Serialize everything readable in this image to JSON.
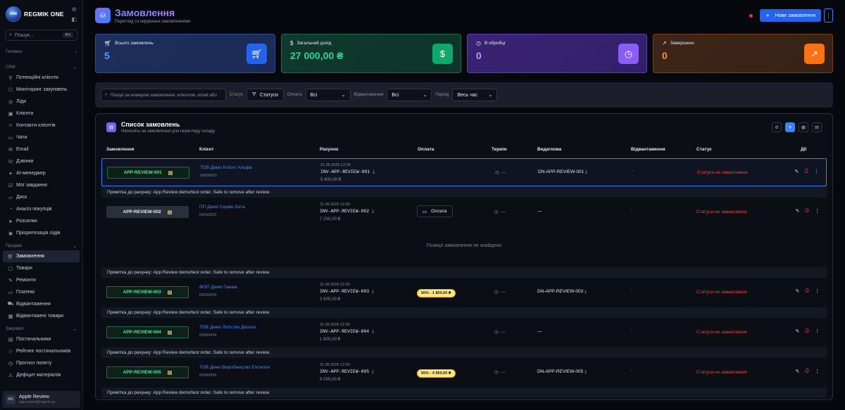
{
  "sidebar": {
    "brand": "REGMIK ONE",
    "logo_text": "ONE",
    "search_placeholder": "Пошук...",
    "search_kbd": "⌘K",
    "sec_main": "Головна",
    "sec_crm": "CRM",
    "crm": [
      "Потенційні клієнти",
      "Моніторинг закупівель",
      "Ліди",
      "Клієнти",
      "Контакти клієнтів",
      "Чати",
      "Email",
      "Дзвінки",
      "AI-менеджер",
      "Мої завдання",
      "Диск",
      "Аналіз покупців",
      "Розсилки",
      "Пріоритезація лідів"
    ],
    "sec_sales": "Продажі",
    "sales": [
      "Замовлення",
      "Товари",
      "Ремонти",
      "Платежі",
      "Відвантаження",
      "Відвантажені товари"
    ],
    "sec_purchases": "Закупівлі",
    "purchases": [
      "Постачальники",
      "Рейтинг постачальників",
      "Прогноз попиту",
      "Дефіцит матеріалів"
    ],
    "user": {
      "initials": "AR",
      "name": "Apple Review",
      "email": "app.review@regmik.ua"
    }
  },
  "header": {
    "title": "Замовлення",
    "subtitle": "Перегляд та керування замовленнями",
    "new_button": "Нове замовлення"
  },
  "stats": [
    {
      "label": "Всього замовлень",
      "value": "5"
    },
    {
      "label": "Загальний дохід",
      "value": "27 000,00 ₴"
    },
    {
      "label": "В обробці",
      "value": "0"
    },
    {
      "label": "Завершено",
      "value": "0"
    }
  ],
  "filters": {
    "search_placeholder": "Пошук за номером замовлення, клієнтом, email або",
    "status_label": "Статус",
    "status_button": "Статуси",
    "payment_label": "Оплата",
    "payment_value": "Всі",
    "shipping_label": "Відвантаження",
    "shipping_value": "Всі",
    "period_label": "Період",
    "period_value": "Весь час"
  },
  "list": {
    "title": "Список замовлень",
    "subtitle": "Натисніть на замовлення для перегляду складу",
    "columns": [
      "Замовлення",
      "Клієнт",
      "Рахунок",
      "Оплата",
      "Термін",
      "Видаткова",
      "Відвантаження",
      "Статус",
      "Дії"
    ],
    "empty_text": "Позиції замовлення не знайдено",
    "note_label": "Примітка до рахунку:",
    "note_text": "App Review demo/test order. Safe to remove after review.",
    "pay_button": "Оплата",
    "term_text": "---",
    "ship_dash": "—",
    "otg_dash": "-",
    "status_text": "Статуси не завантажені"
  },
  "orders": [
    {
      "number": "APP-REVIEW-001",
      "client": "ТОВ Демо Клієнт Альфа",
      "code": "00000001",
      "inv_date": "21.06.2026 12:00",
      "invoice": "INV-APP-REVIEW-001",
      "amount": "5 400,00 ₴",
      "payment": "",
      "shipping_doc": "DN-APP-REVIEW-001"
    },
    {
      "number": "APP-REVIEW-002",
      "client": "ПП Демо Сервіс Бета",
      "code": "00000002",
      "inv_date": "21.06.2026 12:00",
      "invoice": "INV-APP-REVIEW-002",
      "amount": "7 200,00 ₴",
      "payment": "",
      "shipping_doc": ""
    },
    {
      "number": "APP-REVIEW-003",
      "client": "ФОП Демо Гамма",
      "code": "00000003",
      "inv_date": "21.06.2026 12:00",
      "invoice": "INV-APP-REVIEW-003",
      "amount": "3 600,00 ₴",
      "payment": "50% - 1 800,00 ₴",
      "shipping_doc": "DN-APP-REVIEW-003"
    },
    {
      "number": "APP-REVIEW-004",
      "client": "ТОВ Демо Логістик Дельта",
      "code": "00000004",
      "inv_date": "21.06.2026 12:00",
      "invoice": "INV-APP-REVIEW-004",
      "amount": "1 800,00 ₴",
      "payment": "",
      "shipping_doc": ""
    },
    {
      "number": "APP-REVIEW-005",
      "client": "ТОВ Демо Виробництво Епсилон",
      "code": "00000005",
      "inv_date": "21.06.2026 12:00",
      "invoice": "INV-APP-REVIEW-005",
      "amount": "9 000,00 ₴",
      "payment": "55% - 4 950,00 ₴",
      "shipping_doc": "DN-APP-REVIEW-005"
    }
  ]
}
